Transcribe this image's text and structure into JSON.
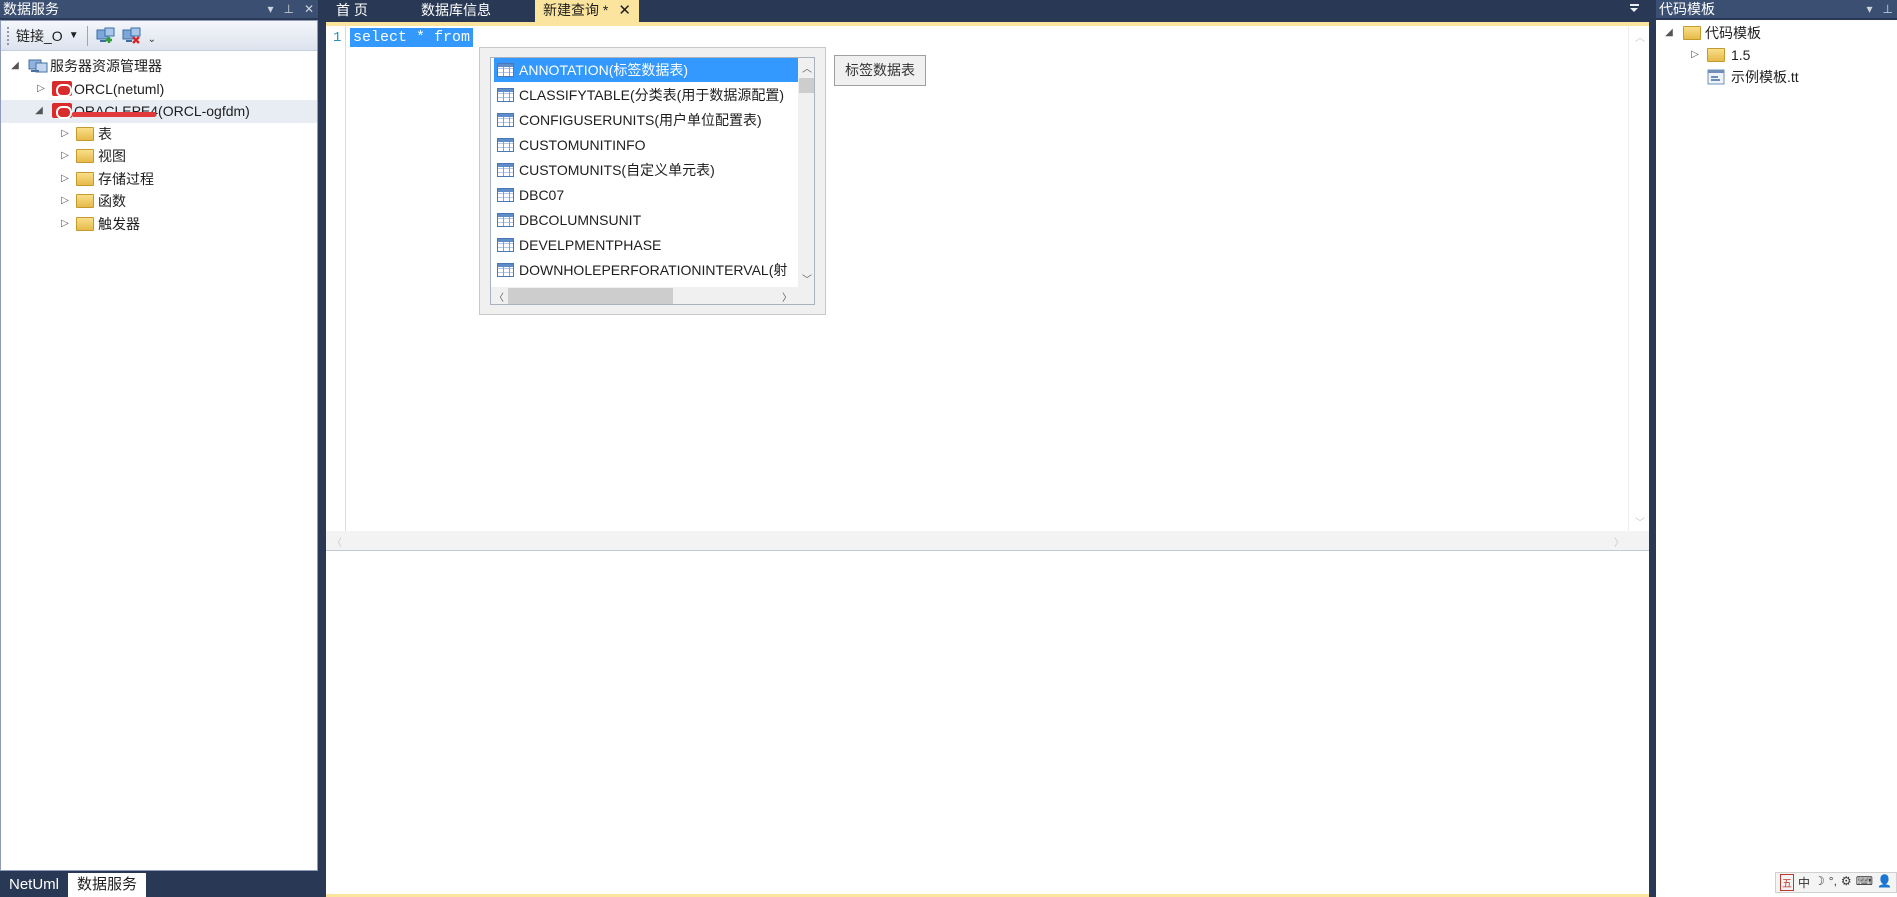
{
  "left_panel": {
    "title": "数据服务",
    "title_buttons": [
      "▾",
      "⊥",
      "✕"
    ],
    "toolbar": {
      "connection_label": "链接_O",
      "dropdown_arrow": "▼",
      "more": "⌄"
    },
    "tree": {
      "root": "服务器资源管理器",
      "connections": [
        {
          "label": "ORCL(netuml)"
        },
        {
          "label_redacted": "ORACLEPE4",
          "label": "(ORCL-ogfdm)"
        }
      ],
      "children": [
        "表",
        "视图",
        "存储过程",
        "函数",
        "触发器"
      ]
    },
    "bottom_tabs": [
      "NetUml",
      "数据服务"
    ]
  },
  "doc_tabs": [
    "首 页",
    "数据库信息",
    "新建查询 *"
  ],
  "doc_tab_close": "✕",
  "editor": {
    "line_number": "1",
    "code": "select * from"
  },
  "completion": {
    "items": [
      "ANNOTATION(标签数据表)",
      "CLASSIFYTABLE(分类表(用于数据源配置)",
      "CONFIGUSERUNITS(用户单位配置表)",
      "CUSTOMUNITINFO",
      "CUSTOMUNITS(自定义单元表)",
      "DBC07",
      "DBCOLUMNSUNIT",
      "DEVELPMENTPHASE",
      "DOWNHOLEPERFORATIONINTERVAL(射"
    ],
    "selected_index": 0,
    "tooltip": "标签数据表"
  },
  "right_panel": {
    "title": "代码模板",
    "title_buttons": [
      "▾",
      "⊥"
    ],
    "tree": {
      "root": "代码模板",
      "children": [
        "1.5",
        "示例模板.tt"
      ]
    },
    "tray": [
      "五",
      "中",
      "☽",
      "°,",
      "⚙",
      "⌨",
      "👤"
    ]
  },
  "colors": {
    "background": "#293955",
    "active_tab": "#fbe59e",
    "selection": "#3399ff",
    "line_number": "#2b91af"
  }
}
